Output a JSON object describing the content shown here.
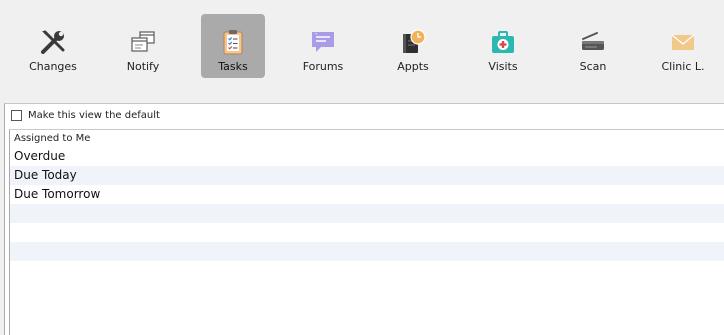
{
  "toolbar": {
    "items": [
      {
        "label": "Changes",
        "icon": "wrench-screwdriver-icon"
      },
      {
        "label": "Notify",
        "icon": "notify-windows-icon"
      },
      {
        "label": "Tasks",
        "icon": "clipboard-checklist-icon",
        "active": true
      },
      {
        "label": "Forums",
        "icon": "chat-bubble-icon"
      },
      {
        "label": "Appts",
        "icon": "calendar-clock-icon"
      },
      {
        "label": "Visits",
        "icon": "medical-kit-icon"
      },
      {
        "label": "Scan",
        "icon": "scanner-icon"
      },
      {
        "label": "Clinic L.",
        "icon": "envelope-icon"
      }
    ]
  },
  "view": {
    "default_checkbox_label": "Make this view the default",
    "default_checked": false
  },
  "task_list": {
    "header": "Assigned to Me",
    "rows": [
      "Overdue",
      "Due Today",
      "Due Tomorrow",
      "",
      "",
      "",
      ""
    ]
  },
  "colors": {
    "active_tab_bg": "#aaaaaa",
    "alt_row_bg": "#f1f3fa",
    "forums_icon": "#a99be8",
    "appts_clock": "#f2b25c",
    "visits_icon": "#2bb8b0",
    "clinic_envelope": "#f1c98a"
  }
}
